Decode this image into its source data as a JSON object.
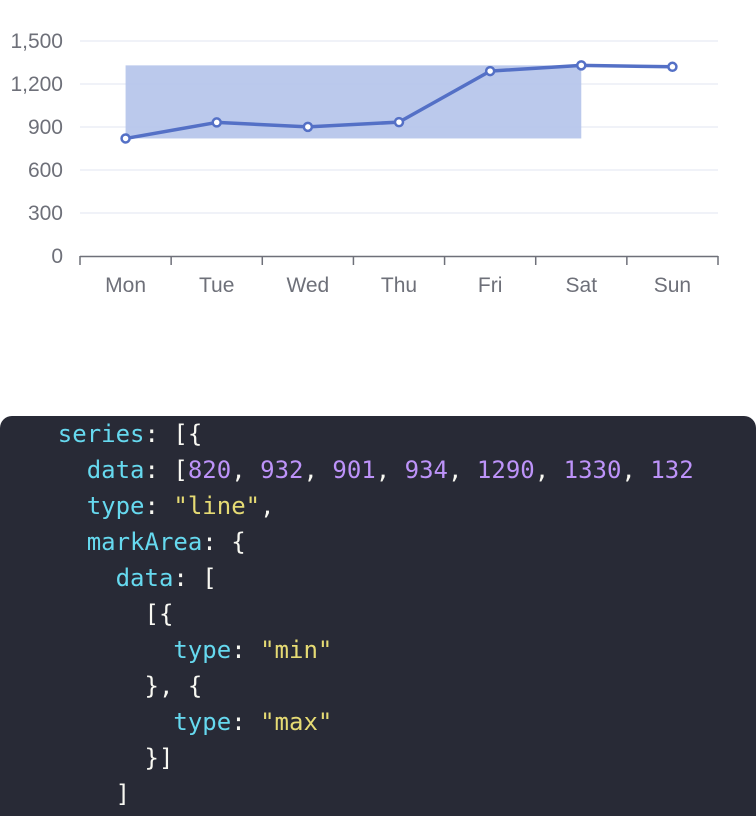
{
  "chart_data": {
    "type": "line",
    "categories": [
      "Mon",
      "Tue",
      "Wed",
      "Thu",
      "Fri",
      "Sat",
      "Sun"
    ],
    "values": [
      820,
      932,
      901,
      934,
      1290,
      1330,
      1320
    ],
    "ylim": [
      0,
      1500
    ],
    "yticks": [
      "0",
      "300",
      "600",
      "900",
      "1,200",
      "1,500"
    ],
    "mark_area": {
      "from": "min",
      "to": "max",
      "y_range": [
        820,
        1330
      ],
      "x_range": [
        "Mon",
        "Sat"
      ]
    },
    "grid": true,
    "colors": {
      "line": "#5470c6",
      "area": "#b4c3ea",
      "grid": "#e0e6f1",
      "axis": "#6e7079"
    },
    "title": "",
    "xlabel": "",
    "ylabel": ""
  },
  "code": {
    "lines": [
      [
        [
          "    ",
          "pun"
        ],
        [
          "series",
          "key"
        ],
        [
          ": [{",
          "pun"
        ]
      ],
      [
        [
          "      ",
          "pun"
        ],
        [
          "data",
          "key"
        ],
        [
          ": [",
          "pun"
        ],
        [
          "820",
          "num"
        ],
        [
          ", ",
          "pun"
        ],
        [
          "932",
          "num"
        ],
        [
          ", ",
          "pun"
        ],
        [
          "901",
          "num"
        ],
        [
          ", ",
          "pun"
        ],
        [
          "934",
          "num"
        ],
        [
          ", ",
          "pun"
        ],
        [
          "1290",
          "num"
        ],
        [
          ", ",
          "pun"
        ],
        [
          "1330",
          "num"
        ],
        [
          ", ",
          "pun"
        ],
        [
          "132",
          "num"
        ]
      ],
      [
        [
          "      ",
          "pun"
        ],
        [
          "type",
          "key"
        ],
        [
          ": ",
          "pun"
        ],
        [
          "\"line\"",
          "str"
        ],
        [
          ",",
          "pun"
        ]
      ],
      [
        [
          "      ",
          "pun"
        ],
        [
          "markArea",
          "key"
        ],
        [
          ": {",
          "pun"
        ]
      ],
      [
        [
          "        ",
          "pun"
        ],
        [
          "data",
          "key"
        ],
        [
          ": [",
          "pun"
        ]
      ],
      [
        [
          "          [{",
          "pun"
        ]
      ],
      [
        [
          "            ",
          "pun"
        ],
        [
          "type",
          "key"
        ],
        [
          ": ",
          "pun"
        ],
        [
          "\"min\"",
          "str"
        ]
      ],
      [
        [
          "          }, {",
          "pun"
        ]
      ],
      [
        [
          "            ",
          "pun"
        ],
        [
          "type",
          "key"
        ],
        [
          ": ",
          "pun"
        ],
        [
          "\"max\"",
          "str"
        ]
      ],
      [
        [
          "          }]",
          "pun"
        ]
      ],
      [
        [
          "        ]",
          "pun"
        ]
      ]
    ]
  }
}
